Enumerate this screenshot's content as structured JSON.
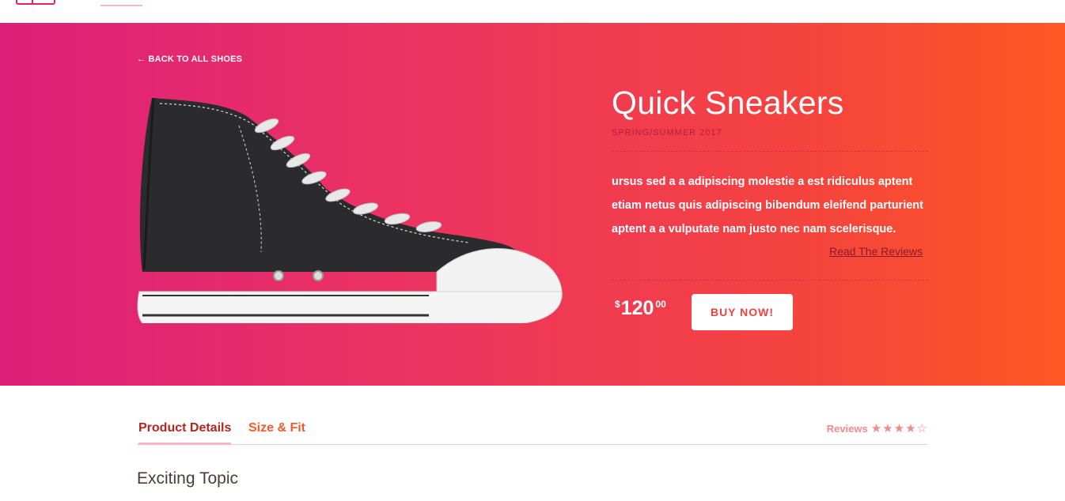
{
  "nav": {
    "logo_icon": "store-logo-icon",
    "icons": [
      "user-icon",
      "cart-icon"
    ]
  },
  "hero": {
    "back_link": "← BACK TO ALL SHOES",
    "product": {
      "name": "Quick Sneakers",
      "season": "SPRING/SUMMER 2017",
      "description": "ursus sed a a adipiscing molestie a est ridiculus aptent etiam netus quis adipiscing bibendum eleifend parturient aptent a a vulputate nam justo nec nam scelerisque.",
      "reviews_link": "Read The Reviews",
      "price_currency": "$",
      "price_whole": "120",
      "price_cents": "00",
      "buy_label": "BUY NOW!"
    },
    "colors": {
      "gradient_start": "#de1f7a",
      "gradient_end": "#ff5722"
    }
  },
  "details": {
    "tabs": [
      {
        "label": "Product Details",
        "active": true
      },
      {
        "label": "Size & Fit",
        "active": false
      }
    ],
    "reviews_label": "Reviews",
    "rating": 4,
    "rating_max": 5,
    "stars_text": "★★★★☆",
    "section_title": "Exciting Topic"
  }
}
